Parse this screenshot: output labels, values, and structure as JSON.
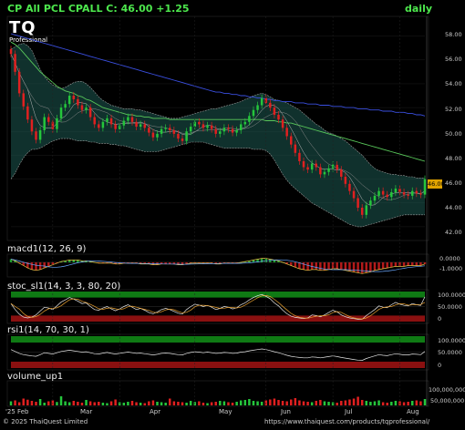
{
  "header": {
    "title": "CP All PCL CPALL C: 46.00 +1.25",
    "interval": "daily"
  },
  "logo": {
    "mark": "TQ",
    "sub": "Professional"
  },
  "price_axis": {
    "ticks": [
      "58.00",
      "56.00",
      "54.00",
      "52.00",
      "50.00",
      "48.00",
      "46.00",
      "44.00",
      "42.00"
    ],
    "last_price": "46.00"
  },
  "panes": {
    "macd": {
      "title": "macd1(12, 26, 9)",
      "ticks": [
        "0.0000",
        "-1.0000"
      ]
    },
    "stoch": {
      "title": "stoc_sl1(14, 3, 3, 80, 20)",
      "ticks": [
        "100.0000",
        "50.0000",
        "0"
      ]
    },
    "rsi": {
      "title": "rsi1(14, 70, 30, 1)",
      "ticks": [
        "100.0000",
        "50.0000",
        "0"
      ]
    },
    "volume": {
      "title": "volume_up1",
      "ticks": [
        "100,000,000",
        "50,000,000"
      ]
    }
  },
  "x_axis": {
    "labels": [
      "'25 Feb",
      "Mar",
      "Apr",
      "May",
      "Jun",
      "Jul",
      "Aug"
    ]
  },
  "footer": {
    "copyright": "© 2025 ThaiQuest Limited",
    "site": "https://www.thaiquest.com/products/tqprofessional/"
  },
  "colors": {
    "up": "#25c63c",
    "down": "#e02020",
    "ma_long": "#3a4fe0",
    "ma_mid": "#59c85a",
    "band_fill": "#1e5a52",
    "band_edge": "#9a9a9a",
    "ob_zone": "#0f7a14",
    "os_zone": "#8a1010",
    "accent_text": "#4de84d",
    "last_price_bg": "#e0a300"
  },
  "chart_data": {
    "type": "candlestick",
    "x": [
      "2025-02-03",
      "2025-08-01"
    ],
    "ylim": [
      41,
      59.5
    ],
    "close": [
      56.5,
      55.0,
      53.2,
      52.1,
      51.0,
      50.0,
      49.3,
      50.1,
      51.2,
      50.8,
      50.2,
      51.1,
      52.0,
      52.3,
      53.0,
      52.7,
      52.2,
      51.8,
      52.0,
      51.2,
      50.6,
      50.3,
      50.8,
      51.1,
      50.6,
      50.2,
      50.5,
      50.9,
      51.2,
      50.8,
      50.4,
      50.6,
      50.3,
      49.9,
      49.5,
      49.8,
      50.2,
      50.3,
      50.1,
      49.8,
      49.4,
      49.2,
      50.0,
      50.4,
      50.8,
      50.6,
      50.3,
      50.5,
      50.2,
      49.8,
      50.0,
      50.3,
      50.2,
      49.9,
      50.1,
      50.6,
      50.8,
      51.3,
      51.8,
      52.2,
      52.8,
      52.4,
      52.0,
      51.4,
      51.0,
      50.3,
      49.6,
      48.9,
      48.2,
      47.5,
      47.0,
      46.8,
      47.3,
      47.0,
      46.4,
      46.6,
      46.9,
      47.2,
      46.8,
      46.2,
      45.6,
      45.0,
      44.4,
      43.6,
      43.0,
      43.8,
      44.2,
      44.6,
      45.0,
      44.7,
      44.5,
      44.9,
      45.2,
      44.9,
      44.7,
      44.6,
      45.0,
      44.8,
      44.7,
      46.0
    ],
    "upper_band": [
      56.9,
      57.1,
      57.3,
      57.4,
      57.2,
      56.8,
      56.0,
      55.2,
      54.6,
      54.2,
      53.9,
      53.7,
      53.6,
      53.7,
      53.9,
      54.1,
      54.2,
      54.2,
      54.0,
      53.7,
      53.3,
      52.9,
      52.6,
      52.4,
      52.2,
      52.1,
      52.0,
      51.9,
      51.9,
      51.9,
      51.8,
      51.8,
      51.7,
      51.6,
      51.5,
      51.4,
      51.3,
      51.2,
      51.1,
      51.1,
      51.1,
      51.2,
      51.3,
      51.4,
      51.5,
      51.6,
      51.7,
      51.8,
      51.9,
      51.9,
      52.0,
      52.1,
      52.2,
      52.3,
      52.4,
      52.5,
      52.7,
      52.8,
      53.0,
      53.1,
      53.2,
      53.1,
      52.9,
      52.7,
      52.6,
      52.5,
      52.4,
      52.2,
      52.0,
      51.8,
      51.5,
      51.2,
      50.9,
      50.6,
      50.4,
      50.1,
      49.9,
      49.8,
      49.6,
      49.4,
      49.2,
      48.9,
      48.6,
      48.3,
      48.0,
      47.6,
      47.2,
      46.9,
      46.7,
      46.6,
      46.5,
      46.4,
      46.4,
      46.3,
      46.3,
      46.2,
      46.2,
      46.1,
      46.1,
      46.1
    ],
    "lower_band": [
      46.0,
      46.5,
      47.2,
      47.8,
      48.2,
      48.5,
      48.5,
      48.6,
      48.8,
      49.0,
      49.2,
      49.3,
      49.4,
      49.4,
      49.4,
      49.3,
      49.2,
      49.2,
      49.2,
      49.1,
      49.1,
      49.0,
      49.0,
      49.0,
      48.9,
      48.9,
      48.8,
      48.8,
      48.7,
      48.6,
      48.5,
      48.4,
      48.3,
      48.3,
      48.3,
      48.3,
      48.4,
      48.5,
      48.6,
      48.7,
      48.8,
      48.9,
      49.0,
      49.1,
      49.1,
      49.1,
      49.1,
      49.0,
      48.9,
      48.8,
      48.7,
      48.6,
      48.6,
      48.6,
      48.6,
      48.6,
      48.6,
      48.6,
      48.5,
      48.5,
      48.5,
      48.4,
      48.1,
      47.6,
      47.0,
      46.4,
      45.9,
      45.5,
      45.2,
      44.9,
      44.6,
      44.3,
      44.0,
      43.8,
      43.6,
      43.4,
      43.2,
      43.0,
      42.8,
      42.6,
      42.4,
      42.2,
      42.1,
      42.0,
      42.0,
      42.1,
      42.2,
      42.3,
      42.4,
      42.5,
      42.6,
      42.7,
      42.8,
      42.9,
      43.0,
      43.0,
      43.0,
      43.0,
      43.0,
      43.0
    ],
    "ma_long": [
      58.2,
      58.1,
      58.0,
      57.9,
      57.8,
      57.7,
      57.6,
      57.5,
      57.4,
      57.3,
      57.2,
      57.1,
      57.0,
      56.9,
      56.8,
      56.7,
      56.6,
      56.5,
      56.4,
      56.3,
      56.2,
      56.1,
      56.0,
      55.9,
      55.8,
      55.7,
      55.6,
      55.5,
      55.4,
      55.3,
      55.2,
      55.1,
      55.0,
      54.9,
      54.8,
      54.7,
      54.6,
      54.5,
      54.4,
      54.3,
      54.2,
      54.1,
      54.0,
      53.9,
      53.8,
      53.7,
      53.6,
      53.5,
      53.4,
      53.3,
      53.3,
      53.2,
      53.2,
      53.1,
      53.1,
      53.0,
      53.0,
      52.9,
      52.9,
      52.8,
      52.8,
      52.7,
      52.7,
      52.6,
      52.6,
      52.5,
      52.5,
      52.5,
      52.4,
      52.4,
      52.4,
      52.3,
      52.3,
      52.3,
      52.2,
      52.2,
      52.2,
      52.1,
      52.1,
      52.1,
      52.0,
      52.0,
      52.0,
      51.9,
      51.9,
      51.9,
      51.8,
      51.8,
      51.8,
      51.7,
      51.7,
      51.7,
      51.6,
      51.6,
      51.6,
      51.5,
      51.5,
      51.4,
      51.4,
      51.3
    ],
    "ma_mid": [
      57.5,
      57.3,
      57.0,
      56.6,
      56.2,
      55.8,
      55.4,
      55.0,
      54.7,
      54.4,
      54.1,
      53.8,
      53.6,
      53.4,
      53.3,
      53.2,
      53.0,
      52.9,
      52.7,
      52.6,
      52.4,
      52.2,
      52.0,
      51.9,
      51.8,
      51.7,
      51.6,
      51.5,
      51.4,
      51.4,
      51.3,
      51.3,
      51.2,
      51.2,
      51.1,
      51.1,
      51.1,
      51.1,
      51.0,
      51.0,
      51.0,
      51.0,
      51.0,
      51.0,
      51.0,
      51.0,
      51.0,
      51.0,
      51.0,
      51.0,
      51.0,
      51.0,
      51.0,
      51.0,
      51.0,
      51.0,
      51.0,
      51.0,
      51.0,
      51.0,
      51.0,
      50.9,
      50.9,
      50.9,
      50.8,
      50.8,
      50.7,
      50.7,
      50.6,
      50.5,
      50.4,
      50.3,
      50.2,
      50.1,
      50.0,
      49.9,
      49.8,
      49.7,
      49.6,
      49.5,
      49.4,
      49.3,
      49.2,
      49.1,
      49.0,
      48.9,
      48.8,
      48.7,
      48.6,
      48.5,
      48.4,
      48.3,
      48.2,
      48.1,
      48.0,
      47.9,
      47.8,
      47.7,
      47.6,
      47.5
    ],
    "volume": [
      18,
      22,
      14,
      30,
      25,
      20,
      16,
      28,
      12,
      18,
      22,
      15,
      40,
      18,
      14,
      20,
      16,
      12,
      24,
      18,
      14,
      16,
      12,
      10,
      18,
      26,
      14,
      12,
      16,
      20,
      14,
      12,
      10,
      18,
      22,
      16,
      14,
      12,
      30,
      18,
      16,
      14,
      12,
      20,
      15,
      18,
      12,
      10,
      14,
      16,
      20,
      18,
      14,
      12,
      16,
      22,
      24,
      28,
      20,
      18,
      16,
      22,
      26,
      30,
      24,
      20,
      18,
      26,
      32,
      22,
      18,
      16,
      14,
      20,
      24,
      18,
      16,
      14,
      12,
      20,
      22,
      26,
      30,
      38,
      24,
      20,
      16,
      18,
      22,
      14,
      12,
      16,
      20,
      18,
      14,
      16,
      20,
      22,
      18,
      28
    ],
    "macd": [
      0.4,
      0.2,
      -0.1,
      -0.4,
      -0.7,
      -0.9,
      -1.0,
      -0.9,
      -0.7,
      -0.5,
      -0.3,
      -0.1,
      0.1,
      0.2,
      0.3,
      0.3,
      0.3,
      0.2,
      0.2,
      0.1,
      0.0,
      -0.1,
      -0.1,
      -0.1,
      -0.1,
      -0.2,
      -0.2,
      -0.1,
      -0.1,
      -0.1,
      -0.1,
      -0.2,
      -0.2,
      -0.2,
      -0.3,
      -0.3,
      -0.2,
      -0.2,
      -0.2,
      -0.2,
      -0.3,
      -0.3,
      -0.2,
      -0.1,
      -0.1,
      -0.1,
      -0.1,
      -0.1,
      -0.1,
      -0.2,
      -0.2,
      -0.1,
      -0.1,
      -0.1,
      -0.1,
      0.0,
      0.1,
      0.2,
      0.3,
      0.4,
      0.5,
      0.5,
      0.4,
      0.3,
      0.2,
      0.0,
      -0.2,
      -0.4,
      -0.6,
      -0.8,
      -0.9,
      -1.0,
      -0.9,
      -0.9,
      -1.0,
      -1.0,
      -0.9,
      -0.8,
      -0.8,
      -0.9,
      -1.0,
      -1.1,
      -1.2,
      -1.3,
      -1.4,
      -1.3,
      -1.2,
      -1.0,
      -0.9,
      -0.8,
      -0.7,
      -0.6,
      -0.5,
      -0.5,
      -0.5,
      -0.4,
      -0.4,
      -0.4,
      -0.4,
      -0.2
    ],
    "stoch": [
      60,
      40,
      25,
      15,
      12,
      15,
      22,
      35,
      48,
      45,
      40,
      52,
      65,
      72,
      80,
      75,
      68,
      60,
      62,
      50,
      40,
      38,
      45,
      50,
      42,
      36,
      42,
      50,
      56,
      48,
      40,
      44,
      38,
      30,
      26,
      32,
      40,
      44,
      40,
      34,
      28,
      25,
      40,
      50,
      58,
      55,
      50,
      54,
      48,
      40,
      44,
      50,
      48,
      42,
      46,
      56,
      62,
      72,
      80,
      86,
      90,
      84,
      76,
      62,
      52,
      38,
      26,
      18,
      14,
      12,
      10,
      12,
      22,
      20,
      16,
      22,
      30,
      38,
      32,
      22,
      16,
      12,
      10,
      8,
      8,
      20,
      30,
      40,
      52,
      48,
      46,
      56,
      64,
      58,
      54,
      52,
      60,
      56,
      54,
      82
    ],
    "rsi": [
      58,
      52,
      46,
      42,
      40,
      38,
      37,
      42,
      48,
      46,
      44,
      48,
      52,
      54,
      56,
      54,
      52,
      50,
      51,
      48,
      45,
      44,
      47,
      49,
      46,
      44,
      46,
      48,
      50,
      48,
      46,
      47,
      45,
      43,
      41,
      43,
      46,
      47,
      46,
      44,
      42,
      41,
      46,
      49,
      51,
      50,
      48,
      50,
      48,
      46,
      47,
      49,
      48,
      46,
      47,
      50,
      51,
      54,
      56,
      58,
      60,
      58,
      55,
      51,
      48,
      44,
      40,
      37,
      35,
      33,
      32,
      32,
      35,
      34,
      32,
      34,
      36,
      38,
      36,
      33,
      31,
      29,
      27,
      25,
      24,
      30,
      34,
      38,
      42,
      40,
      39,
      42,
      45,
      43,
      41,
      41,
      44,
      43,
      42,
      52
    ]
  }
}
